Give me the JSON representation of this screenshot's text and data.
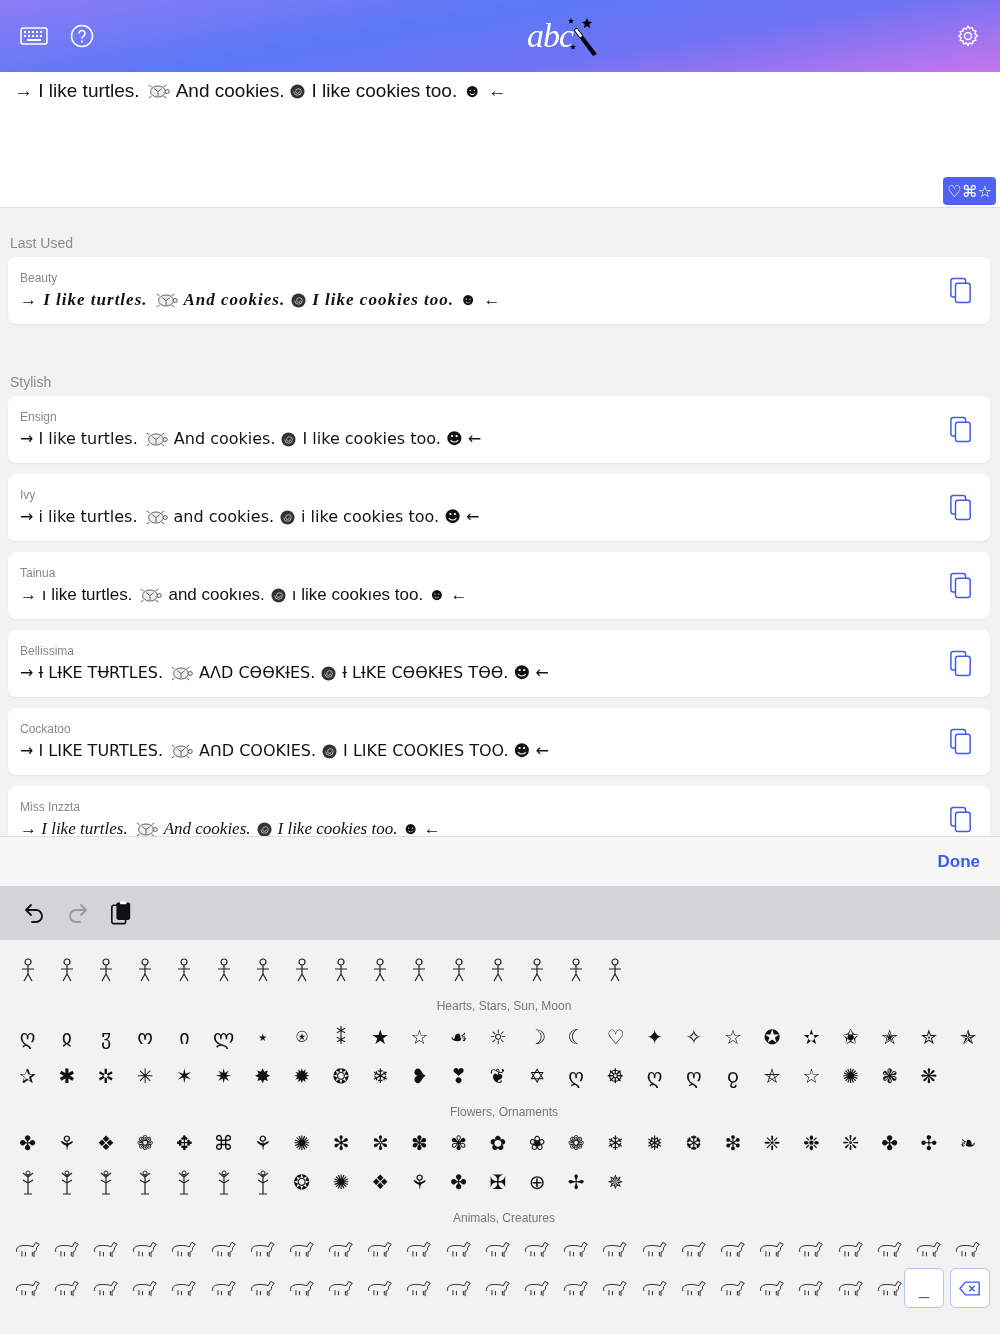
{
  "header": {
    "logo": "abc"
  },
  "input": {
    "parts": [
      "→ I like turtles.",
      "And cookies.",
      "I like cookies too. ☻ ←"
    ],
    "favorites_label": "♡⌘☆"
  },
  "sections": [
    {
      "title": "Last Used",
      "styles": [
        {
          "name": "Beauty",
          "kind": "script",
          "parts": [
            "→ I like turtles.",
            "And cookies.",
            "I like cookies too. ☻ ←"
          ]
        }
      ]
    },
    {
      "title": "Stylish",
      "styles": [
        {
          "name": "Ensign",
          "kind": "geometric",
          "parts": [
            "→ I like turtles.",
            "And cookies.",
            "I like cookies too. ☻ ←"
          ]
        },
        {
          "name": "Ivy",
          "kind": "hooked",
          "parts": [
            "→ i like turtles.",
            "and cookies.",
            "i like cookies too. ☻ ←"
          ]
        },
        {
          "name": "Tainua",
          "kind": "rounded",
          "parts": [
            "→ ı like turtles.",
            "and cookıes.",
            "ı like cookıes too. ☻ ←"
          ]
        },
        {
          "name": "Bellissima",
          "kind": "runic",
          "parts": [
            "→ Ɨ LƗKE TɄRTLES.",
            "AɅD CƟƟKƗES.",
            "Ɨ LƗKE CƟƟKƗES TƟƟ. ☻ ←"
          ]
        },
        {
          "name": "Cockatoo",
          "kind": "capitals",
          "parts": [
            "→ I LIKE TURTLES.",
            "AᑎD COOKIES.",
            "I LIKE COOKIES TOO. ☻ ←"
          ]
        },
        {
          "name": "Miss Inzzta",
          "kind": "cursive",
          "parts": [
            "→ I like turtles.",
            "And cookies.",
            "I like cookies too. ☻ ←"
          ]
        }
      ]
    }
  ],
  "done_label": "Done",
  "toolbar": [
    {
      "kind": "undo",
      "disabled": false
    },
    {
      "kind": "redo",
      "disabled": true
    },
    {
      "kind": "paste",
      "disabled": false
    }
  ],
  "keyboard": {
    "groups": [
      {
        "rows": [
          [
            {
              "kind": "figure"
            },
            {
              "kind": "figure"
            },
            {
              "kind": "figure"
            },
            {
              "kind": "figure"
            },
            {
              "kind": "figure"
            },
            {
              "kind": "figure"
            },
            {
              "kind": "figure"
            },
            {
              "kind": "figure"
            },
            {
              "kind": "figure"
            },
            {
              "kind": "figure"
            },
            {
              "kind": "figure"
            },
            {
              "kind": "figure"
            },
            {
              "kind": "figure"
            },
            {
              "kind": "figure"
            },
            {
              "kind": "figure"
            },
            {
              "kind": "figure"
            }
          ]
        ]
      },
      {
        "title": "Hearts, Stars, Sun, Moon",
        "rows": [
          [
            "ღ",
            "ჲ",
            "ჳ",
            "ო",
            "ი",
            "ლ",
            "⋆",
            "⍟",
            "⁑",
            "★",
            "☆",
            "☙",
            "☼",
            "☽",
            "☾",
            "♡",
            "✦",
            "✧",
            "☆",
            "✪",
            "✫",
            "✬",
            "✭",
            "✮",
            "✯"
          ],
          [
            "✰",
            "✱",
            "✲",
            "✳",
            "✶",
            "✷",
            "✸",
            "✹",
            "❂",
            "❄",
            "❥",
            "❣",
            "❦",
            "✡",
            "ღ",
            "☸",
            "ღ",
            "ღ",
            "ჹ",
            "⛤",
            "☆",
            "✺",
            "❃",
            "❋"
          ]
        ]
      },
      {
        "title": "Flowers, Ornaments",
        "rows": [
          [
            "✤",
            "⚘",
            "❖",
            "❁",
            "✥",
            "⌘",
            "⚘",
            "✺",
            "✻",
            "✼",
            "✽",
            "✾",
            "✿",
            "❀",
            "❁",
            "❄",
            "❅",
            "❆",
            "❇",
            "❈",
            "❉",
            "❊",
            "✤",
            "✣",
            "❧"
          ],
          [
            {
              "kind": "plant"
            },
            {
              "kind": "plant"
            },
            {
              "kind": "plant"
            },
            {
              "kind": "plant"
            },
            {
              "kind": "plant"
            },
            {
              "kind": "plant"
            },
            {
              "kind": "plant"
            },
            "❂",
            "✺",
            "❖",
            "⚘",
            "✤",
            "✠",
            "⊕",
            "✢",
            "✵"
          ]
        ]
      },
      {
        "title": "Animals, Creatures",
        "rows": [
          [
            {
              "kind": "animal"
            },
            {
              "kind": "animal"
            },
            {
              "kind": "animal"
            },
            {
              "kind": "animal"
            },
            {
              "kind": "animal"
            },
            {
              "kind": "animal"
            },
            {
              "kind": "animal"
            },
            {
              "kind": "animal"
            },
            {
              "kind": "animal"
            },
            {
              "kind": "animal"
            },
            {
              "kind": "animal"
            },
            {
              "kind": "animal"
            },
            {
              "kind": "animal"
            },
            {
              "kind": "animal"
            },
            {
              "kind": "animal"
            },
            {
              "kind": "animal"
            },
            {
              "kind": "animal"
            },
            {
              "kind": "animal"
            },
            {
              "kind": "animal"
            },
            {
              "kind": "animal"
            },
            {
              "kind": "animal"
            },
            {
              "kind": "animal"
            },
            {
              "kind": "animal"
            },
            {
              "kind": "animal"
            },
            {
              "kind": "animal"
            }
          ],
          [
            {
              "kind": "animal"
            },
            {
              "kind": "animal"
            },
            {
              "kind": "animal"
            },
            {
              "kind": "animal"
            },
            {
              "kind": "animal"
            },
            {
              "kind": "animal"
            },
            {
              "kind": "animal"
            },
            {
              "kind": "animal"
            },
            {
              "kind": "animal"
            },
            {
              "kind": "animal"
            },
            {
              "kind": "animal"
            },
            {
              "kind": "animal"
            },
            {
              "kind": "animal"
            },
            {
              "kind": "animal"
            },
            {
              "kind": "animal"
            },
            {
              "kind": "animal"
            },
            {
              "kind": "animal"
            },
            {
              "kind": "animal"
            },
            {
              "kind": "animal"
            },
            {
              "kind": "animal"
            },
            {
              "kind": "animal"
            },
            {
              "kind": "animal"
            },
            {
              "kind": "animal"
            }
          ]
        ]
      }
    ],
    "space_label": "_"
  }
}
